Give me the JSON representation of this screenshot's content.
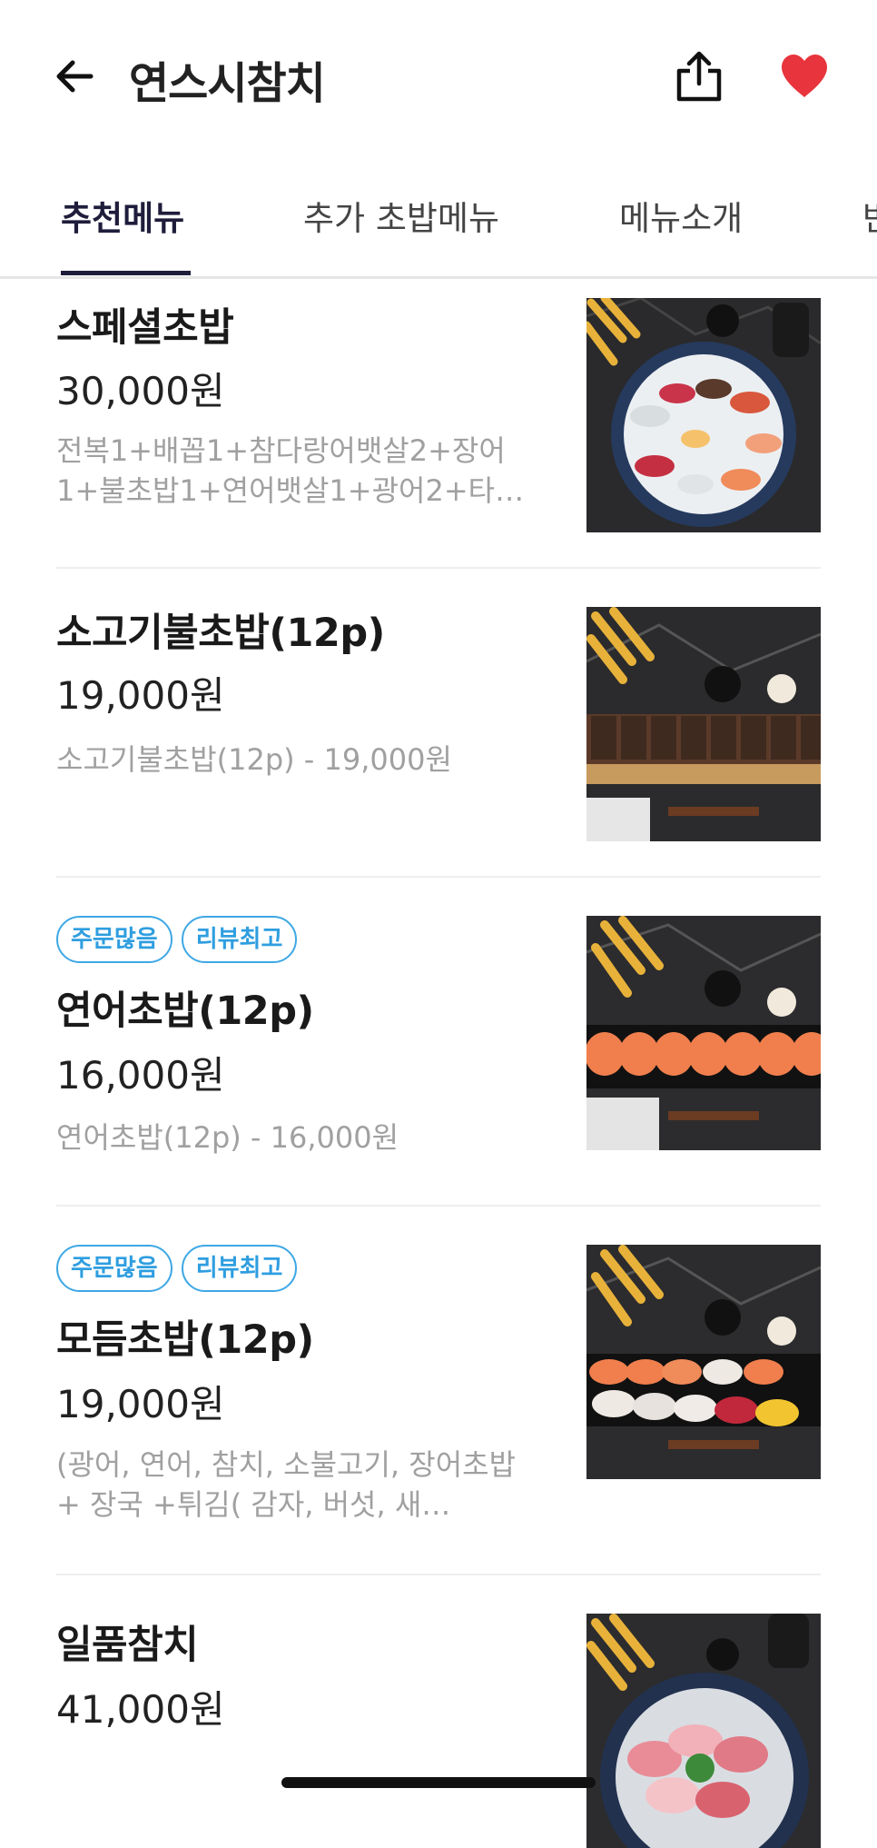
{
  "header": {
    "title": "연스시참치",
    "back_icon": "arrow-left-icon",
    "share_icon": "share-icon",
    "favorite_icon": "heart-icon",
    "favorite_color": "#e8343c"
  },
  "tabs": [
    {
      "label": "추천메뉴",
      "active": true
    },
    {
      "label": "추가 초밥메뉴",
      "active": false
    },
    {
      "label": "메뉴소개",
      "active": false
    },
    {
      "label": "반",
      "active": false
    }
  ],
  "menu_items": [
    {
      "name": "스페셜초밥",
      "price": "30,000원",
      "description": "전복1+배꼽1+참다랑어뱃살2+장어1+불초밥1+연어뱃살1+광어2+타…",
      "badges": []
    },
    {
      "name": "소고기불초밥(12p)",
      "price": "19,000원",
      "description": "소고기불초밥(12p) - 19,000원",
      "badges": []
    },
    {
      "name": "연어초밥(12p)",
      "price": "16,000원",
      "description": "연어초밥(12p) - 16,000원",
      "badges": [
        "주문많음",
        "리뷰최고"
      ]
    },
    {
      "name": "모듬초밥(12p)",
      "price": "19,000원",
      "description": "(광어, 연어, 참치, 소불고기, 장어초밥 + 장국 +튀김( 감자, 버섯, 새…",
      "badges": [
        "주문많음",
        "리뷰최고"
      ]
    },
    {
      "name": "일품참치",
      "price": "41,000원",
      "description": "",
      "badges": []
    }
  ],
  "colors": {
    "accent": "#1f1d3b",
    "badge": "#3ea8e5",
    "muted_text": "#a0a0a0"
  }
}
